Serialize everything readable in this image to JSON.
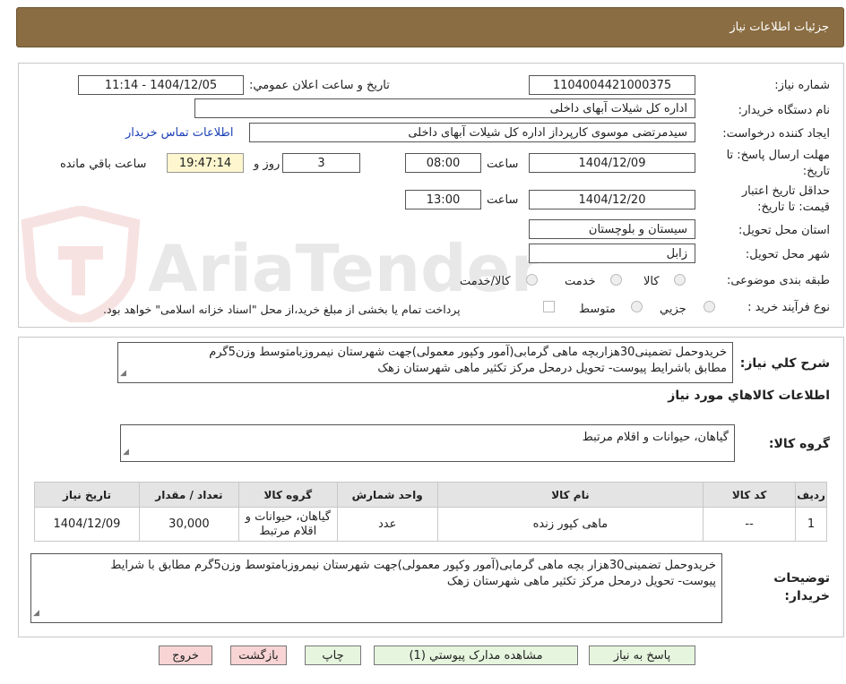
{
  "header": {
    "title": "جزئیات اطلاعات نیاز"
  },
  "watermark": {
    "text": "AriaTender.neT"
  },
  "form": {
    "need_number_label": "شماره نیاز:",
    "need_number": "1104004421000375",
    "announce_label": "تاریخ و ساعت اعلان عمومي:",
    "announce_value": "1404/12/05 - 11:14",
    "buyer_org_label": "نام دستگاه خريدار:",
    "buyer_org": "اداره کل شیلات آبهای داخلی",
    "requester_label": "ايجاد کننده درخواست:",
    "requester": "سیدمرتضی موسوی کارپرداز اداره کل شیلات آبهای داخلی",
    "contact_link": "اطلاعات تماس خريدار",
    "deadline_label_1": "مهلت ارسال پاسخ: تا",
    "deadline_label_2": "تاريخ:",
    "deadline_date": "1404/12/09",
    "time_label": "ساعت",
    "deadline_time": "08:00",
    "days_value": "3",
    "days_label": "روز و",
    "remaining_time": "19:47:14",
    "remaining_label": "ساعت باقي مانده",
    "validity_label_1": "حداقل تاريخ اعتبار",
    "validity_label_2": "قيمت: تا تاريخ:",
    "validity_date": "1404/12/20",
    "validity_time": "13:00",
    "province_label": "استان محل تحويل:",
    "province": "سیستان و بلوچستان",
    "city_label": "شهر محل تحويل:",
    "city": "زابل",
    "category_label": "طبقه بندی موضوعی:",
    "category_options": [
      "کالا",
      "خدمت",
      "کالا/خدمت"
    ],
    "purchase_type_label": "نوع فرآيند خريد :",
    "purchase_type_options": [
      "جزيي",
      "متوسط"
    ],
    "payment_note": "پرداخت تمام يا بخشی از مبلغ خريد،از محل \"اسناد خزانه اسلامی\" خواهد بود."
  },
  "summary": {
    "label": "شرح کلي نياز:",
    "line1": "خریدوحمل تضمینی30هزاربچه ماهی گرمابی(آمور وکپور معمولی)جهت شهرستان نیمروزبامتوسط وزن5گرم",
    "line2": "مطابق باشرایط پیوست- تحویل درمحل مرکز تکثیر ماهی شهرستان زهک"
  },
  "goods_info": {
    "title": "اطلاعات کالاهاي مورد نياز",
    "group_label": "گروه کالا:",
    "group_value": "گیاهان، حیوانات و اقلام مرتبط"
  },
  "table": {
    "headers": [
      "رديف",
      "کد کالا",
      "نام کالا",
      "واحد شمارش",
      "گروه کالا",
      "تعداد / مقدار",
      "تاريخ نياز"
    ],
    "rows": [
      {
        "row": "1",
        "code": "--",
        "name": "ماهی کپور زنده",
        "unit": "عدد",
        "group_line1": "گیاهان، حیوانات و",
        "group_line2": "اقلام مرتبط",
        "qty": "30,000",
        "date": "1404/12/09"
      }
    ]
  },
  "buyer_notes": {
    "label_1": "توضيحات",
    "label_2": "خريدار:",
    "line1": "خریدوحمل تضمینی30هزار بچه ماهی گرمابی(آمور وکپور معمولی)جهت شهرستان نیمروزبامتوسط وزن5گرم مطابق با شرایط",
    "line2": "پیوست- تحویل درمحل مرکز تکثیر ماهی شهرستان زهک"
  },
  "buttons": {
    "reply": "پاسخ به نياز",
    "attachments": "مشاهده مدارک پيوستي (1)",
    "print": "چاپ",
    "back": "بازگشت",
    "exit": "خروج"
  }
}
